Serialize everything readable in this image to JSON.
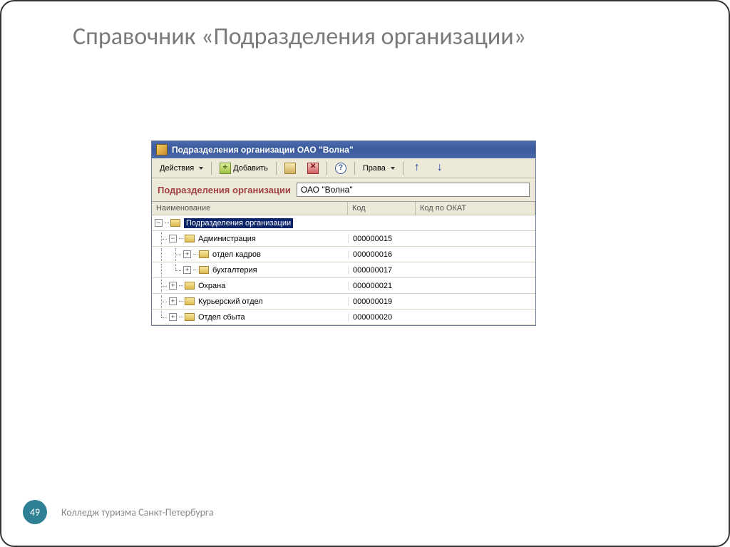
{
  "slide": {
    "title": "Справочник «Подразделения организации»",
    "page_number": "49",
    "footer": "Колледж туризма Санкт-Петербурга"
  },
  "window": {
    "title": "Подразделения организации ОАО \"Волна\"",
    "toolbar": {
      "actions": "Действия",
      "add": "Добавить",
      "rights": "Права"
    },
    "org_label": "Подразделения организации",
    "org_value": "ОАО \"Волна\"",
    "columns": {
      "name": "Наименование",
      "code": "Код",
      "okat": "Код по ОКАТ"
    },
    "rows": [
      {
        "level": 0,
        "exp": "−",
        "label": "Подразделения организации",
        "code": "",
        "selected": true,
        "last": false
      },
      {
        "level": 1,
        "exp": "−",
        "label": "Администрация",
        "code": "000000015",
        "selected": false,
        "last": false
      },
      {
        "level": 2,
        "exp": "+",
        "label": "отдел кадров",
        "code": "000000016",
        "selected": false,
        "last": false
      },
      {
        "level": 2,
        "exp": "+",
        "label": "бухгалтерия",
        "code": "000000017",
        "selected": false,
        "last": true
      },
      {
        "level": 1,
        "exp": "+",
        "label": "Охрана",
        "code": "000000021",
        "selected": false,
        "last": false
      },
      {
        "level": 1,
        "exp": "+",
        "label": "Курьерский отдел",
        "code": "000000019",
        "selected": false,
        "last": false
      },
      {
        "level": 1,
        "exp": "+",
        "label": "Отдел сбыта",
        "code": "000000020",
        "selected": false,
        "last": true
      }
    ]
  }
}
